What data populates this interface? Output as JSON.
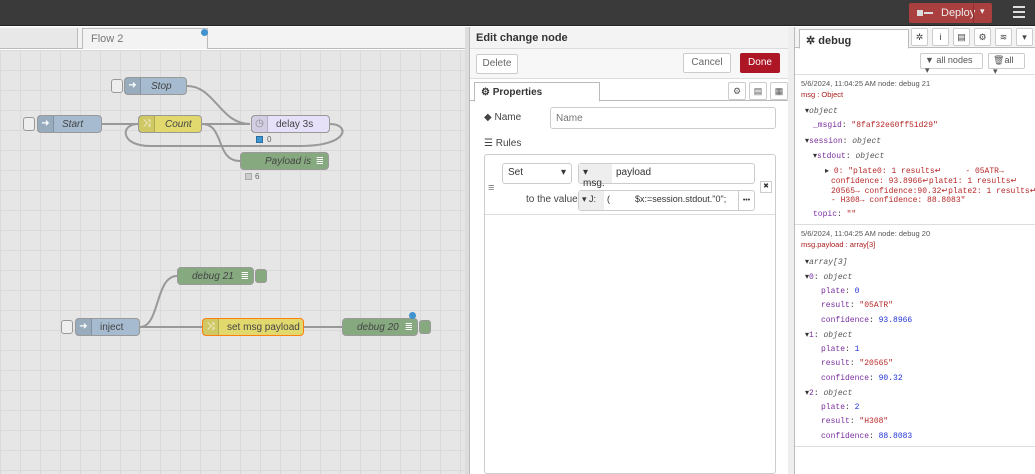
{
  "header": {
    "deploy_label": "Deploy",
    "deploy_caret": "▾"
  },
  "workspace": {
    "tab_flow2": "Flow 2",
    "nodes": {
      "stop": "Stop",
      "start": "Start",
      "count": "Count",
      "delay": "delay 3s",
      "payload_is": "Payload is",
      "debug21": "debug 21",
      "inject": "inject",
      "set_payload": "set msg payload",
      "debug20": "debug 20"
    },
    "badges": {
      "delay_count": "0",
      "payload_count": "6"
    }
  },
  "edit": {
    "title": "Edit change node",
    "delete_label": "Delete",
    "cancel_label": "Cancel",
    "done_label": "Done",
    "tab_properties": "Properties",
    "name_label": "Name",
    "name_placeholder": "Name",
    "rules_label": "Rules",
    "rule_action": "Set",
    "rule_prefix": "msg.",
    "rule_property": "payload",
    "to_value_label": "to the value",
    "value_type_glyph": "J:",
    "value_expr": "(          $x:=session.stdout.\"0\";",
    "more_label": "•••",
    "remove_label": "✖"
  },
  "debug": {
    "tab_label": "debug",
    "filter_nodes": "all nodes",
    "filter_clear": "all",
    "messages": [
      {
        "meta": "5/6/2024, 11:04:25 AM   node: debug 21",
        "type": "msg : Object",
        "lines": {
          "obj": "object",
          "msgid_k": "_msgid",
          "msgid_v": "\"8faf32e60ff51d29\"",
          "session": "session",
          "session_t": "object",
          "stdout": "stdout",
          "stdout_t": "object",
          "s0": "0: \"plate0: 1 results↵     - 05ATR→",
          "s1": "confidence: 93.8966↵plate1: 1 results↵     -",
          "s2": "20565→ confidence:90.32↵plate2: 1 results↵",
          "s3": "- H308→ confidence: 88.8083\"",
          "topic_k": "topic",
          "topic_v": "\"\""
        }
      },
      {
        "meta": "5/6/2024, 11:04:25 AM   node: debug 20",
        "type": "msg.payload : array[3]",
        "lines": {
          "arr": "array[3]",
          "i0": "0",
          "i0t": "object",
          "p0": "0",
          "r0": "\"05ATR\"",
          "c0": "93.8966",
          "i1": "1",
          "i1t": "object",
          "p1": "1",
          "r1": "\"20565\"",
          "c1": "90.32",
          "i2": "2",
          "i2t": "object",
          "p2": "2",
          "r2": "\"H308\"",
          "c2": "88.8083",
          "pk": "plate",
          "rk": "result",
          "ck": "confidence"
        }
      }
    ]
  },
  "colors": {
    "deploy": "#aa3f3f",
    "done": "#ad1625",
    "change_node": "#e2d96e",
    "debug_node": "#87a980",
    "inject_node": "#a6bbcf"
  }
}
